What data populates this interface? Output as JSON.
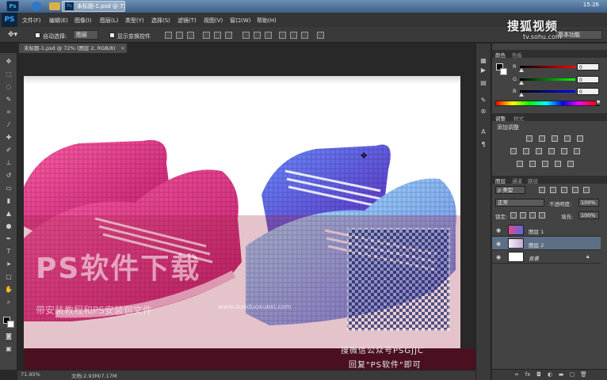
{
  "taskbar": {
    "ps_label": "Ps",
    "active_window_label": "未标题-1.psd @ 72...",
    "time": "15:26"
  },
  "menubar": {
    "logo": "PS",
    "items": [
      "文件(F)",
      "编辑(E)",
      "图像(I)",
      "图层(L)",
      "类型(Y)",
      "选择(S)",
      "滤镜(T)",
      "视图(V)",
      "窗口(W)",
      "帮助(H)"
    ]
  },
  "options": {
    "auto_select_label": "自动选择:",
    "auto_select_value": "图层",
    "show_transform_label": "显示变换控件",
    "workspace": "基本功能"
  },
  "watermark": {
    "sohu_big": "搜狐视频",
    "sohu_url": "tv.sohu.com",
    "ps_text": "PS软件下载",
    "sub_text": "带安装教程和PS安装包文件",
    "site": "www.duoduoxuexi.com",
    "wechat": "搜微信公众号PSGJJC",
    "reply": "回复\"PS软件\"即可"
  },
  "document": {
    "tab_title": "未标题-1.psd @ 72% (图层 2, RGB/8)",
    "close": "×",
    "zoom": "71.95%",
    "doc_size": "文档:2.93M/7.17M"
  },
  "color_panel": {
    "tab_color": "颜色",
    "tab_swatches": "色板",
    "channels": [
      {
        "label": "R",
        "value": "0",
        "gradient": "#ff0000"
      },
      {
        "label": "G",
        "value": "0",
        "gradient": "#00ff00"
      },
      {
        "label": "B",
        "value": "0",
        "gradient": "#0000ff"
      }
    ]
  },
  "adjustments_panel": {
    "tab_adjust": "调整",
    "tab_styles": "样式",
    "add_label": "添加调整"
  },
  "layers_panel": {
    "tab_layers": "图层",
    "tab_channels": "通道",
    "tab_paths": "路径",
    "kind_filter": "ρ 类型",
    "blend_mode": "正常",
    "opacity_label": "不透明度:",
    "opacity_value": "100%",
    "lock_label": "锁定:",
    "fill_label": "填充:",
    "fill_value": "100%",
    "layers": [
      {
        "name": "图层 1",
        "selected": false,
        "thumb": "#e04a8a"
      },
      {
        "name": "图层 2",
        "selected": true,
        "thumb": "#e8e8f4"
      },
      {
        "name": "背景",
        "selected": false,
        "thumb": "#ffffff",
        "locked": true
      }
    ]
  },
  "colors": {
    "accent": "#31a8ff",
    "selection": "#5c6f84"
  }
}
